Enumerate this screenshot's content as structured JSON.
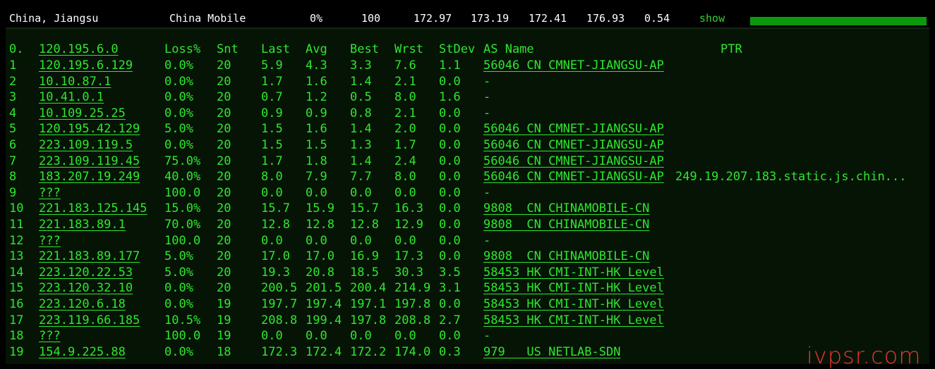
{
  "summary": {
    "location": "China, Jiangsu",
    "isp": "China Mobile",
    "loss": "0%",
    "sent": "100",
    "last": "172.97",
    "avg": "173.19",
    "best": "172.41",
    "worst": "176.93",
    "stdev": "0.54",
    "show_label": "show",
    "bar_fill": 1.0,
    "bar_color": "#0c9a0c"
  },
  "headers": {
    "hop": "0.",
    "host": "120.195.6.0",
    "loss": "Loss%",
    "snt": "Snt",
    "last": "Last",
    "avg": "Avg",
    "best": "Best",
    "wrst": "Wrst",
    "stdev": "StDev",
    "as": "AS Name",
    "ptr": "PTR"
  },
  "hops": [
    {
      "hop": "1",
      "host": "120.195.6.129",
      "loss": "0.0%",
      "snt": "20",
      "last": "5.9",
      "avg": "4.3",
      "best": "3.3",
      "wrst": "7.6",
      "stdev": "1.1",
      "as": "56046 CN CMNET-JIANGSU-AP",
      "ptr": ""
    },
    {
      "hop": "2",
      "host": "10.10.87.1",
      "loss": "0.0%",
      "snt": "20",
      "last": "1.7",
      "avg": "1.6",
      "best": "1.4",
      "wrst": "2.1",
      "stdev": "0.0",
      "as": "-",
      "ptr": ""
    },
    {
      "hop": "3",
      "host": "10.41.0.1",
      "loss": "0.0%",
      "snt": "20",
      "last": "0.7",
      "avg": "1.2",
      "best": "0.5",
      "wrst": "8.0",
      "stdev": "1.6",
      "as": "-",
      "ptr": ""
    },
    {
      "hop": "4",
      "host": "10.109.25.25",
      "loss": "0.0%",
      "snt": "20",
      "last": "0.9",
      "avg": "0.9",
      "best": "0.8",
      "wrst": "2.1",
      "stdev": "0.0",
      "as": "-",
      "ptr": ""
    },
    {
      "hop": "5",
      "host": "120.195.42.129",
      "loss": "5.0%",
      "snt": "20",
      "last": "1.5",
      "avg": "1.6",
      "best": "1.4",
      "wrst": "2.0",
      "stdev": "0.0",
      "as": "56046 CN CMNET-JIANGSU-AP",
      "ptr": ""
    },
    {
      "hop": "6",
      "host": "223.109.119.5",
      "loss": "0.0%",
      "snt": "20",
      "last": "1.5",
      "avg": "1.5",
      "best": "1.3",
      "wrst": "1.7",
      "stdev": "0.0",
      "as": "56046 CN CMNET-JIANGSU-AP",
      "ptr": ""
    },
    {
      "hop": "7",
      "host": "223.109.119.45",
      "loss": "75.0%",
      "snt": "20",
      "last": "1.7",
      "avg": "1.8",
      "best": "1.4",
      "wrst": "2.4",
      "stdev": "0.0",
      "as": "56046 CN CMNET-JIANGSU-AP",
      "ptr": ""
    },
    {
      "hop": "8",
      "host": "183.207.19.249",
      "loss": "40.0%",
      "snt": "20",
      "last": "8.0",
      "avg": "7.9",
      "best": "7.7",
      "wrst": "8.0",
      "stdev": "0.0",
      "as": "56046 CN CMNET-JIANGSU-AP",
      "ptr": "249.19.207.183.static.js.chin..."
    },
    {
      "hop": "9",
      "host": "???",
      "loss": "100.0",
      "snt": "20",
      "last": "0.0",
      "avg": "0.0",
      "best": "0.0",
      "wrst": "0.0",
      "stdev": "0.0",
      "as": "-",
      "ptr": ""
    },
    {
      "hop": "10",
      "host": "221.183.125.145",
      "loss": "15.0%",
      "snt": "20",
      "last": "15.7",
      "avg": "15.9",
      "best": "15.7",
      "wrst": "16.3",
      "stdev": "0.0",
      "as": "9808  CN CHINAMOBILE-CN",
      "ptr": ""
    },
    {
      "hop": "11",
      "host": "221.183.89.1",
      "loss": "70.0%",
      "snt": "20",
      "last": "12.8",
      "avg": "12.8",
      "best": "12.8",
      "wrst": "12.9",
      "stdev": "0.0",
      "as": "9808  CN CHINAMOBILE-CN",
      "ptr": ""
    },
    {
      "hop": "12",
      "host": "???",
      "loss": "100.0",
      "snt": "20",
      "last": "0.0",
      "avg": "0.0",
      "best": "0.0",
      "wrst": "0.0",
      "stdev": "0.0",
      "as": "-",
      "ptr": ""
    },
    {
      "hop": "13",
      "host": "221.183.89.177",
      "loss": "5.0%",
      "snt": "20",
      "last": "17.0",
      "avg": "17.0",
      "best": "16.9",
      "wrst": "17.3",
      "stdev": "0.0",
      "as": "9808  CN CHINAMOBILE-CN",
      "ptr": ""
    },
    {
      "hop": "14",
      "host": "223.120.22.53",
      "loss": "5.0%",
      "snt": "20",
      "last": "19.3",
      "avg": "20.8",
      "best": "18.5",
      "wrst": "30.3",
      "stdev": "3.5",
      "as": "58453 HK CMI-INT-HK Level",
      "ptr": ""
    },
    {
      "hop": "15",
      "host": "223.120.32.10",
      "loss": "0.0%",
      "snt": "20",
      "last": "200.5",
      "avg": "201.5",
      "best": "200.4",
      "wrst": "214.9",
      "stdev": "3.1",
      "as": "58453 HK CMI-INT-HK Level",
      "ptr": ""
    },
    {
      "hop": "16",
      "host": "223.120.6.18",
      "loss": "0.0%",
      "snt": "19",
      "last": "197.7",
      "avg": "197.4",
      "best": "197.1",
      "wrst": "197.8",
      "stdev": "0.0",
      "as": "58453 HK CMI-INT-HK Level",
      "ptr": ""
    },
    {
      "hop": "17",
      "host": "223.119.66.185",
      "loss": "10.5%",
      "snt": "19",
      "last": "208.8",
      "avg": "199.4",
      "best": "197.8",
      "wrst": "208.8",
      "stdev": "2.7",
      "as": "58453 HK CMI-INT-HK Level",
      "ptr": ""
    },
    {
      "hop": "18",
      "host": "???",
      "loss": "100.0",
      "snt": "19",
      "last": "0.0",
      "avg": "0.0",
      "best": "0.0",
      "wrst": "0.0",
      "stdev": "0.0",
      "as": "-",
      "ptr": ""
    },
    {
      "hop": "19",
      "host": "154.9.225.88",
      "loss": "0.0%",
      "snt": "18",
      "last": "172.3",
      "avg": "172.4",
      "best": "172.2",
      "wrst": "174.0",
      "stdev": "0.3",
      "as": "979   US NETLAB-SDN",
      "ptr": ""
    }
  ],
  "watermark": "ivpsr.com"
}
